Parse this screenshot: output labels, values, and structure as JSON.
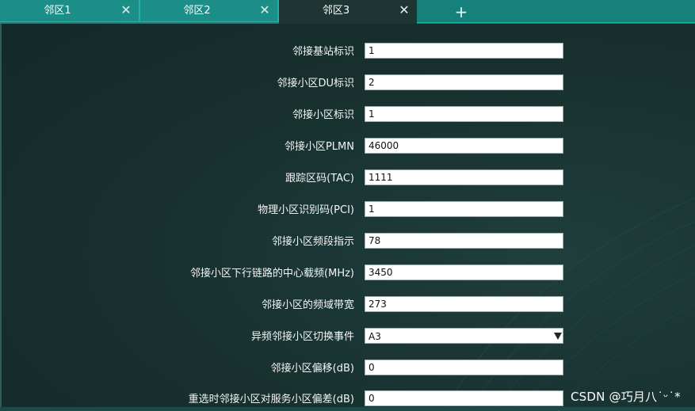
{
  "tabs": [
    {
      "label": "邻区1",
      "active": false
    },
    {
      "label": "邻区2",
      "active": false
    },
    {
      "label": "邻区3",
      "active": true
    }
  ],
  "icons": {
    "close": "close-icon",
    "add": "plus-icon",
    "dropdown": "chevron-down-icon"
  },
  "tab_close_glyph": "✕",
  "tab_add_glyph": "+",
  "form": {
    "rows": [
      {
        "label": "邻接基站标识",
        "value": "1"
      },
      {
        "label": "邻接小区DU标识",
        "value": "2"
      },
      {
        "label": "邻接小区标识",
        "value": "1"
      },
      {
        "label": "邻接小区PLMN",
        "value": "46000"
      },
      {
        "label": "跟踪区码(TAC)",
        "value": "1111"
      },
      {
        "label": "物理小区识别码(PCI)",
        "value": "1"
      },
      {
        "label": "邻接小区频段指示",
        "value": "78"
      },
      {
        "label": "邻接小区下行链路的中心载频(MHz)",
        "value": "3450"
      },
      {
        "label": "邻接小区的频域带宽",
        "value": "273"
      },
      {
        "label": "异频邻接小区切换事件",
        "value": "A3",
        "type": "select"
      },
      {
        "label": "邻接小区偏移(dB)",
        "value": "0"
      },
      {
        "label": "重选时邻接小区对服务小区偏差(dB)",
        "value": "0"
      }
    ]
  },
  "watermark": "CSDN @巧月八˙ᵕ˙*",
  "colors": {
    "tab_bar": "#16807a",
    "background": "#17302e",
    "active_tab": "#1e3533"
  }
}
